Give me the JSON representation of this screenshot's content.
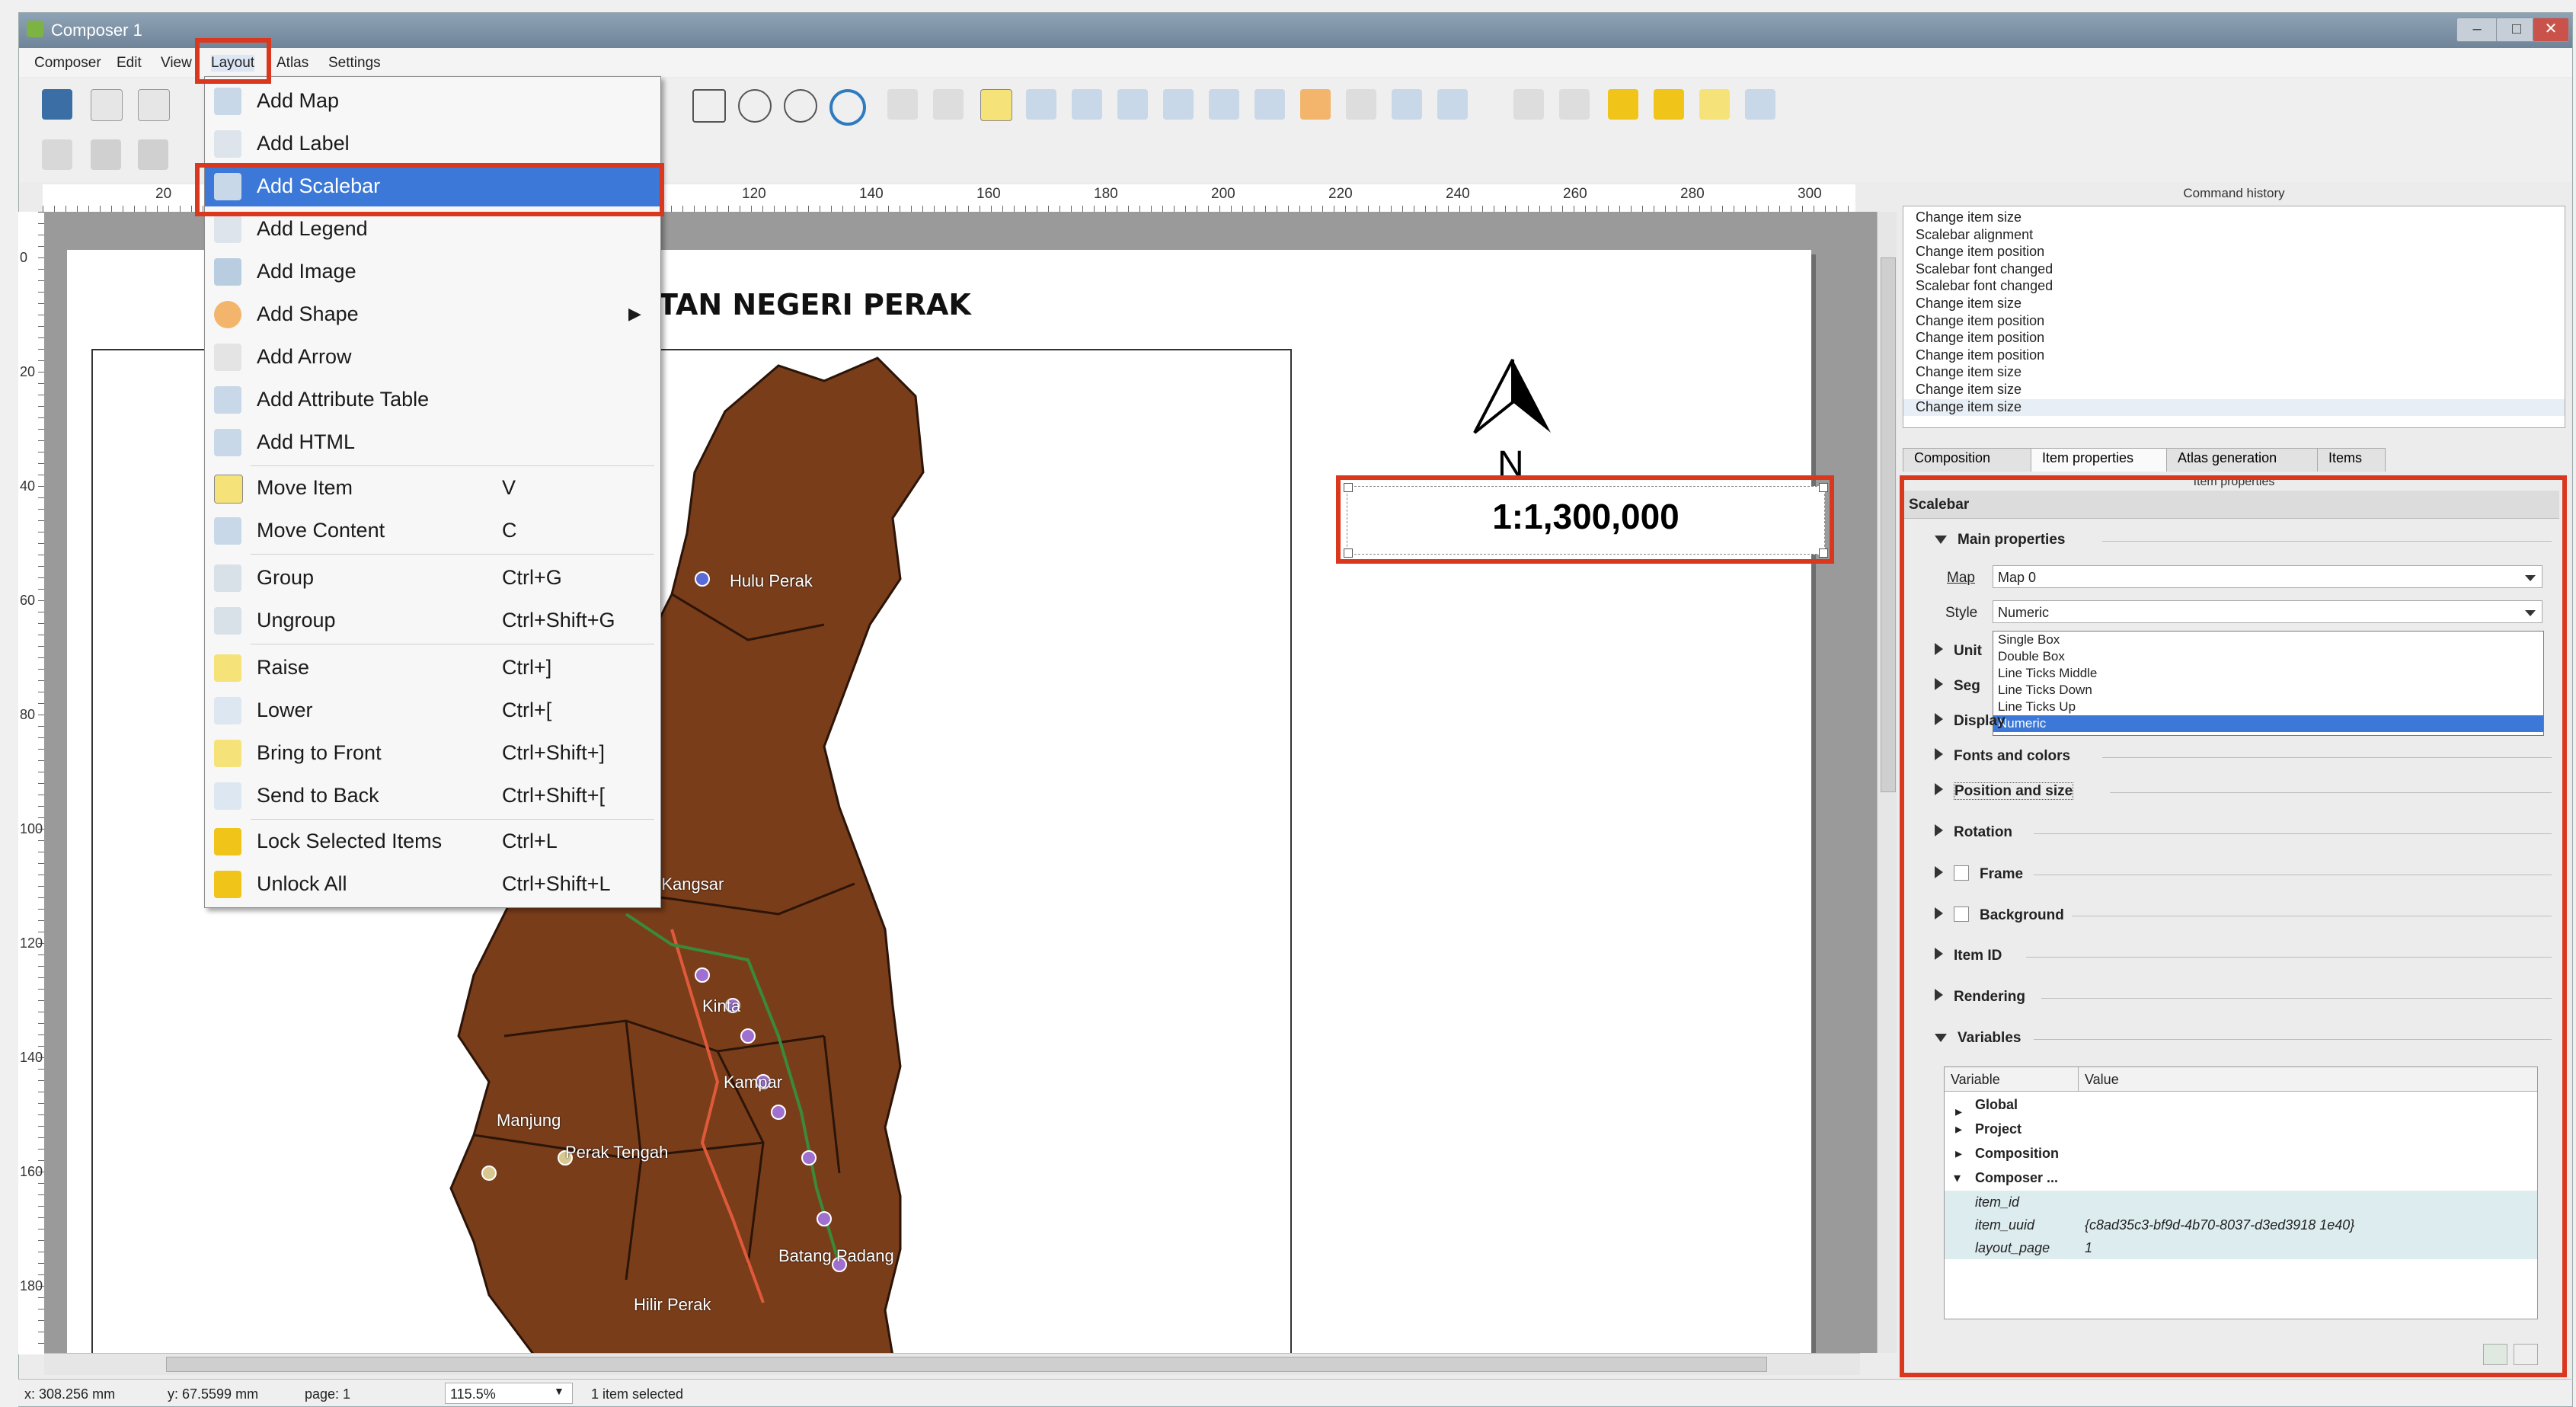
{
  "window": {
    "title": "Composer 1"
  },
  "menubar": [
    "Composer",
    "Edit",
    "View",
    "Layout",
    "Atlas",
    "Settings"
  ],
  "layout_menu": [
    {
      "label": "Add Map",
      "shortcut": ""
    },
    {
      "label": "Add Label",
      "shortcut": ""
    },
    {
      "label": "Add Scalebar",
      "shortcut": ""
    },
    {
      "label": "Add Legend",
      "shortcut": ""
    },
    {
      "label": "Add Image",
      "shortcut": ""
    },
    {
      "label": "Add Shape",
      "shortcut": ""
    },
    {
      "label": "Add Arrow",
      "shortcut": ""
    },
    {
      "label": "Add Attribute Table",
      "shortcut": ""
    },
    {
      "label": "Add HTML",
      "shortcut": ""
    },
    {
      "label": "Move Item",
      "shortcut": "V"
    },
    {
      "label": "Move Content",
      "shortcut": "C"
    },
    {
      "label": "Group",
      "shortcut": "Ctrl+G"
    },
    {
      "label": "Ungroup",
      "shortcut": "Ctrl+Shift+G"
    },
    {
      "label": "Raise",
      "shortcut": "Ctrl+]"
    },
    {
      "label": "Lower",
      "shortcut": "Ctrl+["
    },
    {
      "label": "Bring to Front",
      "shortcut": "Ctrl+Shift+]"
    },
    {
      "label": "Send to Back",
      "shortcut": "Ctrl+Shift+["
    },
    {
      "label": "Lock Selected Items",
      "shortcut": "Ctrl+L"
    },
    {
      "label": "Unlock All",
      "shortcut": "Ctrl+Shift+L"
    }
  ],
  "ruler": {
    "h_ticks": [
      "20",
      "120",
      "140",
      "160",
      "180",
      "200",
      "220",
      "240",
      "260",
      "280",
      "300"
    ],
    "v_ticks": [
      "0",
      "20",
      "40",
      "60",
      "80",
      "100",
      "120",
      "140",
      "160",
      "180"
    ]
  },
  "canvas": {
    "map_title": "TAN NEGERI PERAK",
    "north_label": "N",
    "scale_text": "1:1,300,000",
    "places": [
      "Hulu Perak",
      "a Kangsar",
      "Kinta",
      "Kampar",
      "Manjung",
      "Perak Tengah",
      "Batang Padang",
      "Hilir Perak"
    ]
  },
  "command_history": {
    "title": "Command history",
    "items": [
      "Change item size",
      "Scalebar alignment",
      "Change item position",
      "Scalebar font changed",
      "Scalebar font changed",
      "Change item size",
      "Change item position",
      "Change item position",
      "Change item position",
      "Change item size",
      "Change item size",
      "Change item size"
    ]
  },
  "tabs": [
    "Composition",
    "Item properties",
    "Atlas generation",
    "Items"
  ],
  "item_properties": {
    "header": "Item properties",
    "section": "Scalebar",
    "main_properties": "Main properties",
    "map_label": "Map",
    "map_value": "Map 0",
    "style_label": "Style",
    "style_value": "Numeric",
    "style_options": [
      "Single Box",
      "Double Box",
      "Line Ticks Middle",
      "Line Ticks Down",
      "Line Ticks Up",
      "Numeric"
    ],
    "partial_groups": [
      "Unit",
      "Seg",
      "Display"
    ],
    "groups": [
      "Fonts and colors",
      "Position and size",
      "Rotation",
      "Frame",
      "Background",
      "Item ID",
      "Rendering",
      "Variables"
    ]
  },
  "variables": {
    "col_variable": "Variable",
    "col_value": "Value",
    "rows": [
      {
        "name": "Global",
        "value": ""
      },
      {
        "name": "Project",
        "value": ""
      },
      {
        "name": "Composition",
        "value": ""
      },
      {
        "name": "Composer ...",
        "value": ""
      },
      {
        "name": "item_id",
        "value": ""
      },
      {
        "name": "item_uuid",
        "value": "{c8ad35c3-bf9d-4b70-8037-d3ed3918 1e40}"
      },
      {
        "name": "layout_page",
        "value": "1"
      }
    ]
  },
  "statusbar": {
    "x": "x: 308.256 mm",
    "y": "y: 67.5599 mm",
    "page": "page: 1",
    "zoom": "115.5%",
    "selection": "1 item selected"
  },
  "colors": {
    "highlight_red": "#d9381e",
    "menu_selection": "#3b78d8",
    "map_fill": "#7a3d1a"
  }
}
